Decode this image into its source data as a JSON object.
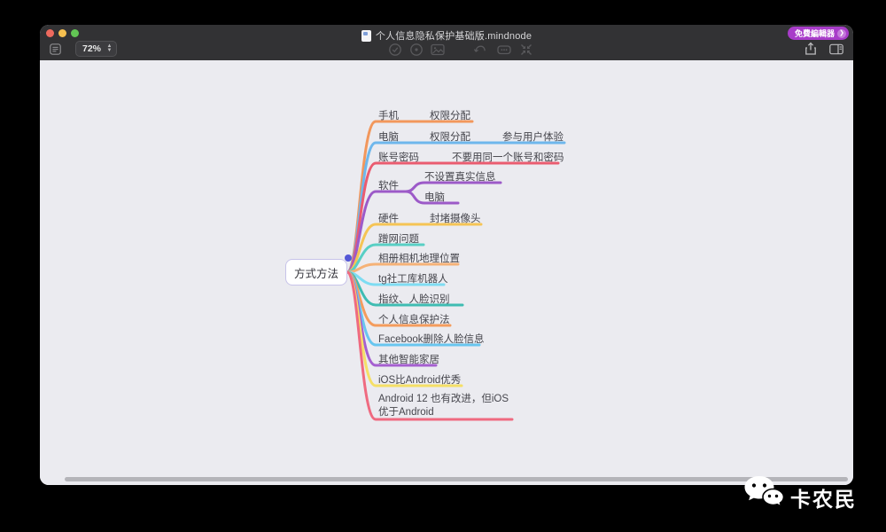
{
  "window": {
    "title": "个人信息隐私保护基础版.mindnode",
    "badge_label": "免費編輯器",
    "zoom_value": "72%"
  },
  "icons": [
    "outline-toggle",
    "zoom-stepper",
    "task-check",
    "focus",
    "image",
    "undo",
    "tag",
    "fold",
    "share",
    "format-panel",
    "document",
    "wechat-logo"
  ],
  "colors": {
    "titlebar": "#323234",
    "canvas": "#ebebf0",
    "badge": "#a83cc9",
    "node_border": "#c7c3e9",
    "selection_dot": "#5457d6"
  },
  "map": {
    "root": {
      "label": "方式方法"
    },
    "branches": [
      {
        "label": "手机",
        "color": "#f2975c",
        "children": [
          {
            "label": "权限分配"
          }
        ]
      },
      {
        "label": "电脑",
        "color": "#6eb7ec",
        "children": [
          {
            "label": "权限分配"
          },
          {
            "label": "参与用户体验"
          }
        ]
      },
      {
        "label": "账号密码",
        "color": "#ea5c70",
        "children": [
          {
            "label": "不要用同一个账号和密码"
          }
        ]
      },
      {
        "label": "软件",
        "color": "#9c5ac8",
        "children": [
          {
            "label": "不设置真实信息"
          },
          {
            "label": "电脑"
          }
        ]
      },
      {
        "label": "硬件",
        "color": "#f5c455",
        "children": [
          {
            "label": "封堵摄像头"
          }
        ]
      },
      {
        "label": "蹭网问题",
        "color": "#58cfc4",
        "children": []
      },
      {
        "label": "相册相机地理位置",
        "color": "#f6b277",
        "children": []
      },
      {
        "label": "tg社工库机器人",
        "color": "#7edcf2",
        "children": []
      },
      {
        "label": "指纹、人脸识别",
        "color": "#3fbcb2",
        "children": []
      },
      {
        "label": "个人信息保护法",
        "color": "#f49c5d",
        "children": []
      },
      {
        "label": "Facebook删除人脸信息",
        "color": "#68c6ef",
        "children": []
      },
      {
        "label": "其他智能家居",
        "color": "#a55fd0",
        "children": []
      },
      {
        "label": "iOS比Android优秀",
        "color": "#f5df66",
        "children": []
      },
      {
        "label": "Android 12 也有改进，但iOS优于Android",
        "color": "#ef6a80",
        "children": []
      }
    ]
  },
  "watermark": {
    "label": "卡农民"
  }
}
